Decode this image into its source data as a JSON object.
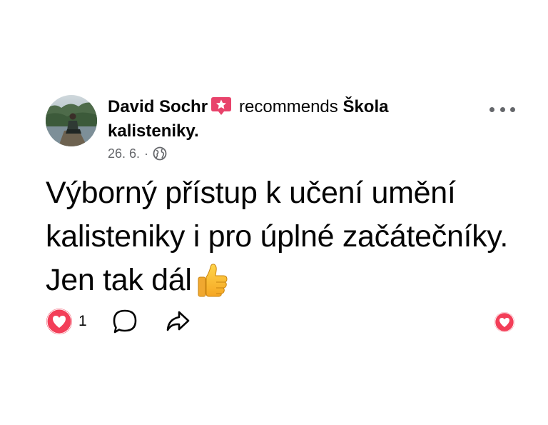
{
  "post": {
    "author": "David Sochr",
    "action_text": "recommends",
    "page_name": "Škola",
    "page_name_cont": "kalisteniky.",
    "date": "26. 6.",
    "separator": "·",
    "audience_icon": "globe-icon",
    "body_text": "Výborný přístup k učení umění kalisteniky i pro úplné začátečníky. Jen tak dál",
    "body_emoji": "thumbs-up-icon",
    "reaction_count": "1"
  },
  "icons": {
    "badge": "star-badge-icon",
    "more": "more-options-icon",
    "reaction": "heart-reaction-icon",
    "comment": "comment-icon",
    "share": "share-icon"
  },
  "colors": {
    "reaction_red": "#f33e58",
    "badge_pink": "#e8436b",
    "meta_gray": "#65676b",
    "text": "#050505"
  }
}
